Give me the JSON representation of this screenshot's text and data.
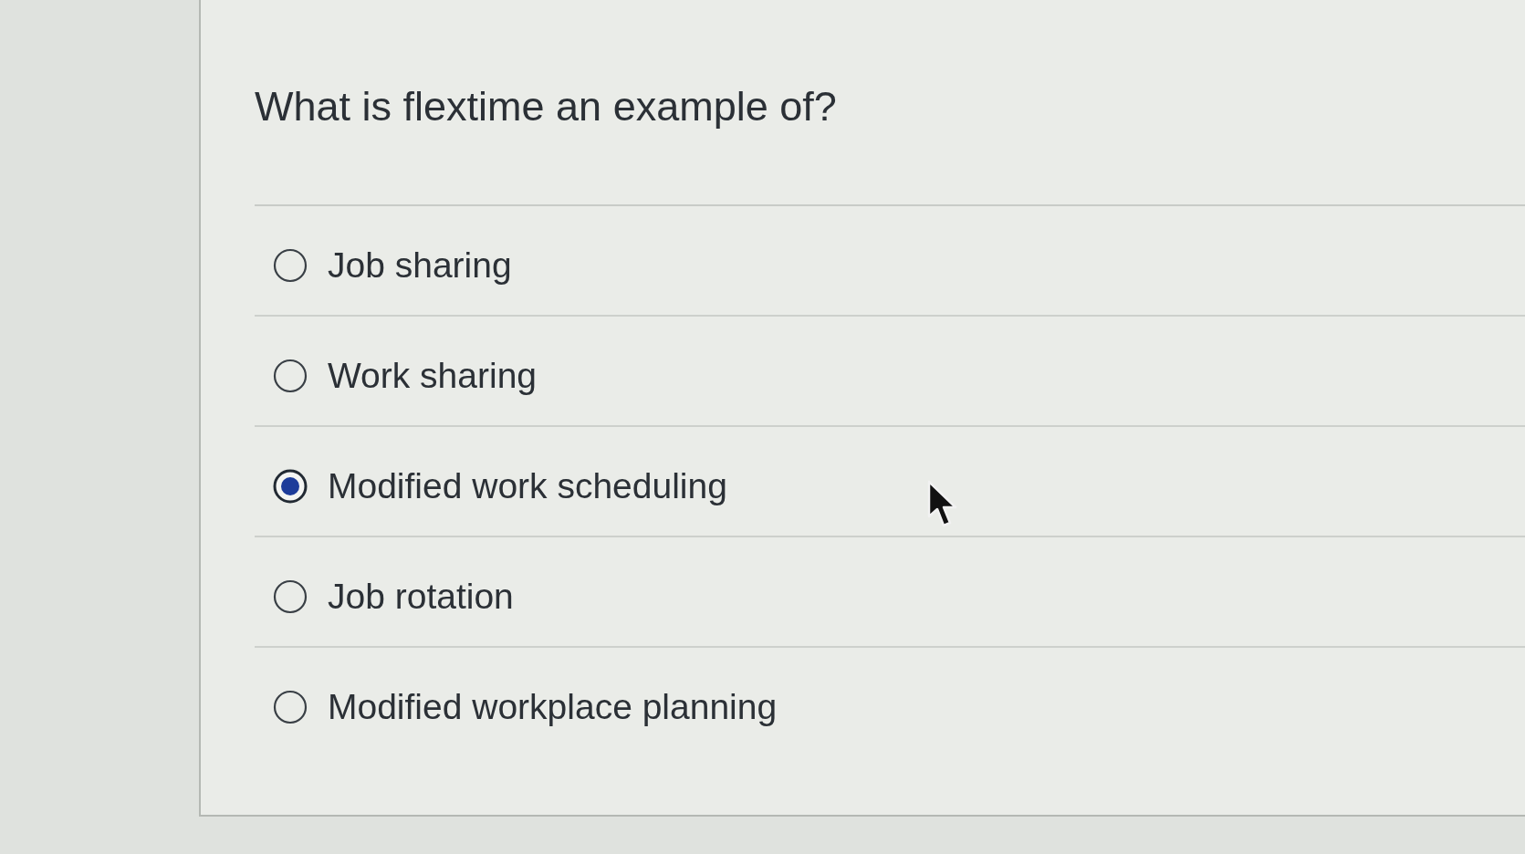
{
  "question": "What is flextime an example of?",
  "options": [
    {
      "label": "Job sharing",
      "selected": false
    },
    {
      "label": "Work sharing",
      "selected": false
    },
    {
      "label": "Modified work scheduling",
      "selected": true
    },
    {
      "label": "Job rotation",
      "selected": false
    },
    {
      "label": "Modified workplace planning",
      "selected": false
    }
  ]
}
